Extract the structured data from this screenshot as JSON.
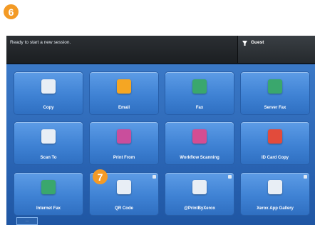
{
  "callouts": {
    "step_a": "6",
    "step_b": "7"
  },
  "status": {
    "message": "Ready to start a new session."
  },
  "user": {
    "name": "Guest",
    "icon": "user-icon"
  },
  "tiles": [
    {
      "label": "Copy",
      "icon": "copy-icon",
      "color": "#e8eef5"
    },
    {
      "label": "Email",
      "icon": "email-icon",
      "color": "#f5a623"
    },
    {
      "label": "Fax",
      "icon": "fax-icon",
      "color": "#3aa76d"
    },
    {
      "label": "Server Fax",
      "icon": "server-fax-icon",
      "color": "#3aa76d"
    },
    {
      "label": "Scan To",
      "icon": "scan-to-icon",
      "color": "#e8eef5"
    },
    {
      "label": "Print From",
      "icon": "print-from-icon",
      "color": "#c94e9c"
    },
    {
      "label": "Workflow Scanning",
      "icon": "workflow-scanning-icon",
      "color": "#d44d92"
    },
    {
      "label": "ID Card Copy",
      "icon": "id-card-copy-icon",
      "color": "#e24b3b"
    },
    {
      "label": "Internet Fax",
      "icon": "internet-fax-icon",
      "color": "#3aa76d"
    },
    {
      "label": "QR Code",
      "icon": "qr-code-icon",
      "color": "#e8eef5"
    },
    {
      "label": "@PrintByXerox",
      "icon": "print-by-xerox-icon",
      "color": "#e8eef5"
    },
    {
      "label": "Xerox App Gallery",
      "icon": "app-gallery-icon",
      "color": "#e8eef5"
    }
  ],
  "footer": {
    "more_label": "···"
  }
}
